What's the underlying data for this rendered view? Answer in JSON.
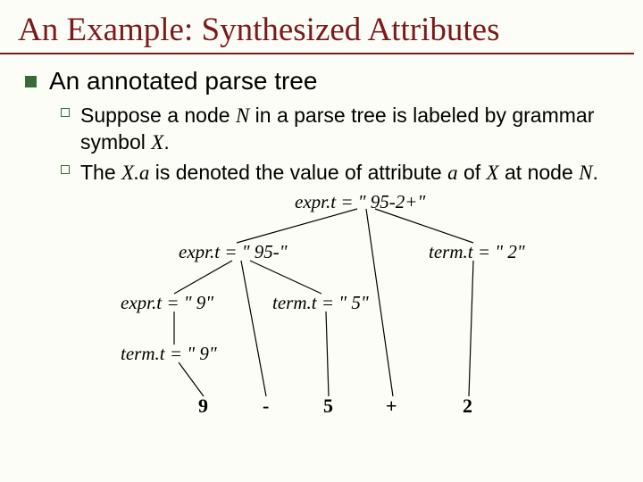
{
  "title": "An Example: Synthesized Attributes",
  "heading": "An annotated parse tree",
  "bullets": [
    {
      "pre1": "Suppose a node ",
      "n": "N",
      "mid1": " in a parse tree is labeled by grammar symbol ",
      "x": "X",
      "post1": "."
    },
    {
      "pre2": "The ",
      "xa": "X.a",
      "mid2": " is denoted the value of attribute ",
      "a": "a",
      "mid3": " of ",
      "x2": "X",
      "mid4": " at node ",
      "n2": "N",
      "post2": "."
    }
  ],
  "tree": {
    "n1": "expr.t = \" 95-2+\"",
    "n2": "expr.t = \" 95-\"",
    "n3": "term.t = \" 2\"",
    "n4": "expr.t = \" 9\"",
    "n5": "term.t = \" 5\"",
    "n6": "term.t = \" 9\"",
    "l1": "9",
    "l2": "-",
    "l3": "5",
    "l4": "+",
    "l5": "2"
  }
}
